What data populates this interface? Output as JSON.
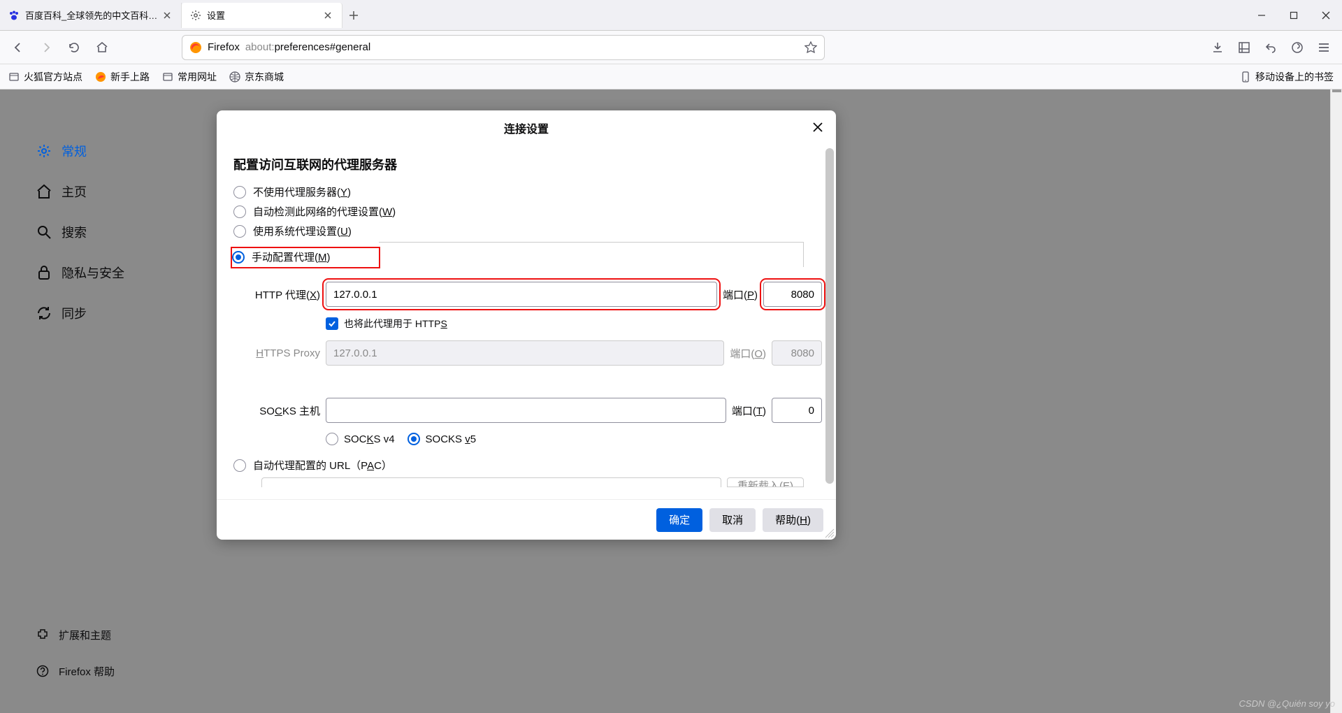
{
  "tabs": [
    {
      "title": "百度百科_全球领先的中文百科全书",
      "favicon": "baidu"
    },
    {
      "title": "设置",
      "favicon": "gear"
    }
  ],
  "toolbar": {
    "firefox_label": "Firefox",
    "url_prefix": "about:",
    "url_path": "preferences#general"
  },
  "bookmarks": {
    "items": [
      "火狐官方站点",
      "新手上路",
      "常用网址",
      "京东商城"
    ],
    "mobile": "移动设备上的书签"
  },
  "sidebar": {
    "items": [
      {
        "key": "general",
        "label": "常规",
        "icon": "gear",
        "active": true
      },
      {
        "key": "home",
        "label": "主页",
        "icon": "home"
      },
      {
        "key": "search",
        "label": "搜索",
        "icon": "search"
      },
      {
        "key": "privacy",
        "label": "隐私与安全",
        "icon": "lock"
      },
      {
        "key": "sync",
        "label": "同步",
        "icon": "sync"
      }
    ],
    "bottom": [
      {
        "key": "ext",
        "label": "扩展和主题",
        "icon": "puzzle"
      },
      {
        "key": "help",
        "label": "Firefox 帮助",
        "icon": "help"
      }
    ]
  },
  "modal": {
    "title": "连接设置",
    "heading": "配置访问互联网的代理服务器",
    "opt_no_proxy": "不使用代理服务器(",
    "opt_no_proxy_u": "Y",
    "opt_auto": "自动检测此网络的代理设置(",
    "opt_auto_u": "W",
    "opt_system": "使用系统代理设置(",
    "opt_system_u": "U",
    "opt_manual": "手动配置代理(",
    "opt_manual_u": "M",
    "http_label_pre": "HTTP 代理(",
    "http_label_u": "X",
    "http_value": "127.0.0.1",
    "port_label_pre": "端口(",
    "http_port_u": "P",
    "http_port": "8080",
    "also_https_pre": "也将此代理用于 HTTP",
    "also_https_u": "S",
    "https_label_pre": "H",
    "https_label_post": "TTPS Proxy",
    "https_value": "127.0.0.1",
    "https_port_u": "O",
    "https_port": "8080",
    "socks_label_pre": "SO",
    "socks_label_u": "C",
    "socks_label_post": "KS 主机",
    "socks_port_u": "T",
    "socks_port": "0",
    "socks_v4_pre": "SOC",
    "socks_v4_u": "K",
    "socks_v4_post": "S v4",
    "socks_v5_pre": "SOCKS ",
    "socks_v5_u": "v",
    "socks_v5_post": "5",
    "pac_pre": "自动代理配置的 URL（P",
    "pac_u": "A",
    "pac_post": "C）",
    "reload": "重新载入(E)",
    "ok": "确定",
    "cancel": "取消",
    "help_pre": "帮助(",
    "help_u": "H"
  },
  "watermark": "CSDN @¿Quién soy yo"
}
